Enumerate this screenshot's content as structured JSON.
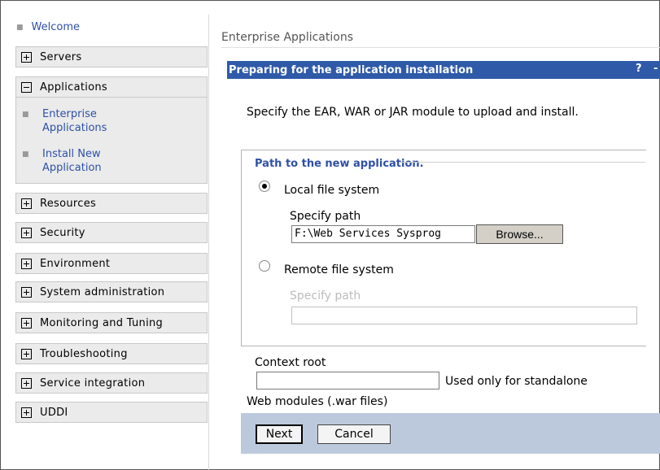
{
  "nav": {
    "welcome": "Welcome",
    "servers": "Servers",
    "applications": "Applications",
    "enterprise_apps": [
      "Enterprise",
      "Applications"
    ],
    "install_new": [
      "Install New",
      "Application"
    ],
    "resources": "Resources",
    "security": "Security",
    "environment": "Environment",
    "system_admin": "System administration",
    "monitoring": "Monitoring and Tuning",
    "troubleshooting": "Troubleshooting",
    "service_integration": "Service integration",
    "uddi": "UDDI"
  },
  "breadcrumb": "Enterprise Applications",
  "panel": {
    "title": "Preparing for the application installation",
    "help": "?",
    "minimize": "-"
  },
  "instruction": "Specify the EAR, WAR or JAR module to upload and install.",
  "path_group": {
    "legend": "Path to the new application.",
    "local": {
      "label": "Local file system",
      "checked": true,
      "specify_label": "Specify path",
      "value": "F:\\Web Services Sysprog",
      "browse": "Browse..."
    },
    "remote": {
      "label": "Remote file system",
      "checked": false,
      "specify_label": "Specify path",
      "value": ""
    }
  },
  "context_root": {
    "label": "Context root",
    "value": "",
    "note_inline": "Used only for standalone",
    "note_wrap": "Web modules (.war files)"
  },
  "buttons": {
    "next": "Next",
    "cancel": "Cancel"
  },
  "colors": {
    "title_bar": "#2f5aa8",
    "link": "#2e50a6",
    "footer": "#bcc9dd",
    "nav_bg": "#ebebeb"
  }
}
